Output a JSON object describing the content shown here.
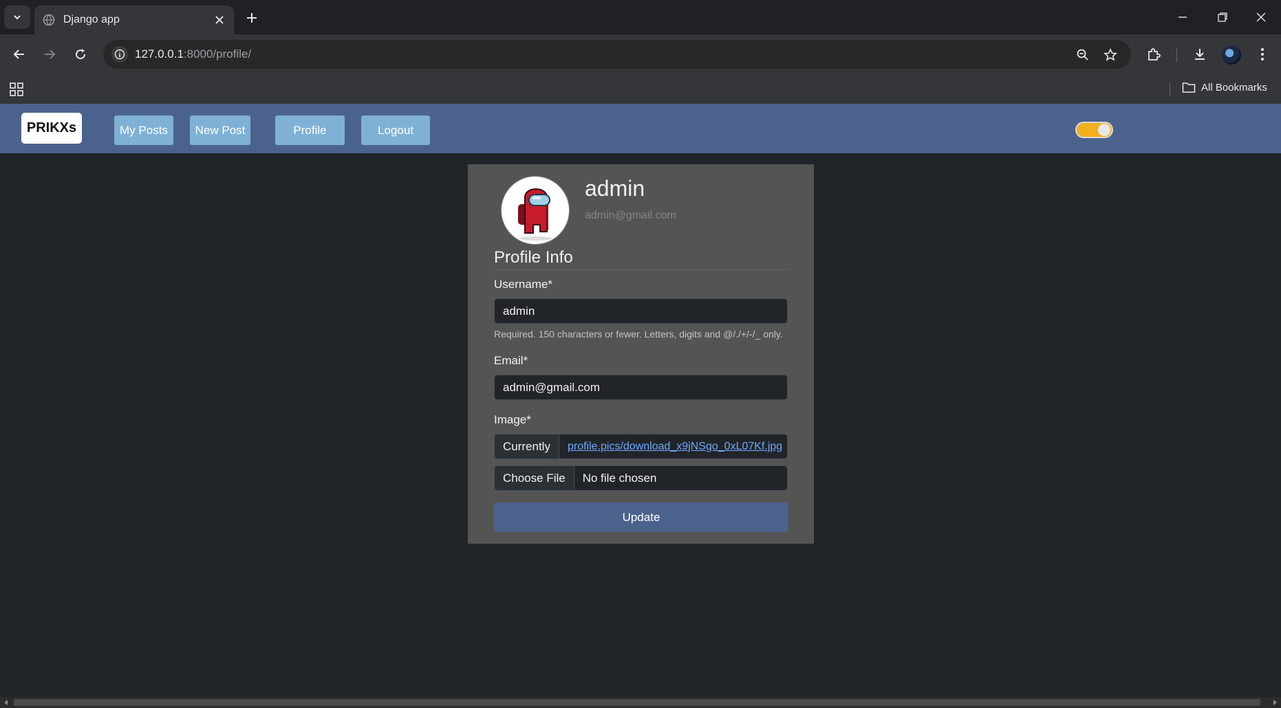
{
  "browser": {
    "tab_title": "Django app",
    "url_host": "127.0.0.1",
    "url_rest": ":8000/profile/",
    "bookmarks_label": "All Bookmarks"
  },
  "navbar": {
    "brand": "PRIKXs",
    "links": [
      {
        "label": "My Posts"
      },
      {
        "label": "New Post"
      },
      {
        "label": "Profile"
      },
      {
        "label": "Logout"
      }
    ],
    "theme_toggle_on": true,
    "accent_color": "#4b638c"
  },
  "profile": {
    "username": "admin",
    "email": "admin@gmail.com"
  },
  "form": {
    "section_title": "Profile Info",
    "username_label": "Username*",
    "username_value": "admin",
    "username_help": "Required. 150 characters or fewer. Letters, digits and @/./+/-/_ only.",
    "email_label": "Email*",
    "email_value": "admin@gmail.com",
    "image_label": "Image*",
    "currently_label": "Currently",
    "current_image": "profile.pics/download_x9jNSgo_0xL07Kf.jpg",
    "choose_file_label": "Choose File",
    "no_file_label": "No file chosen",
    "submit_label": "Update"
  }
}
